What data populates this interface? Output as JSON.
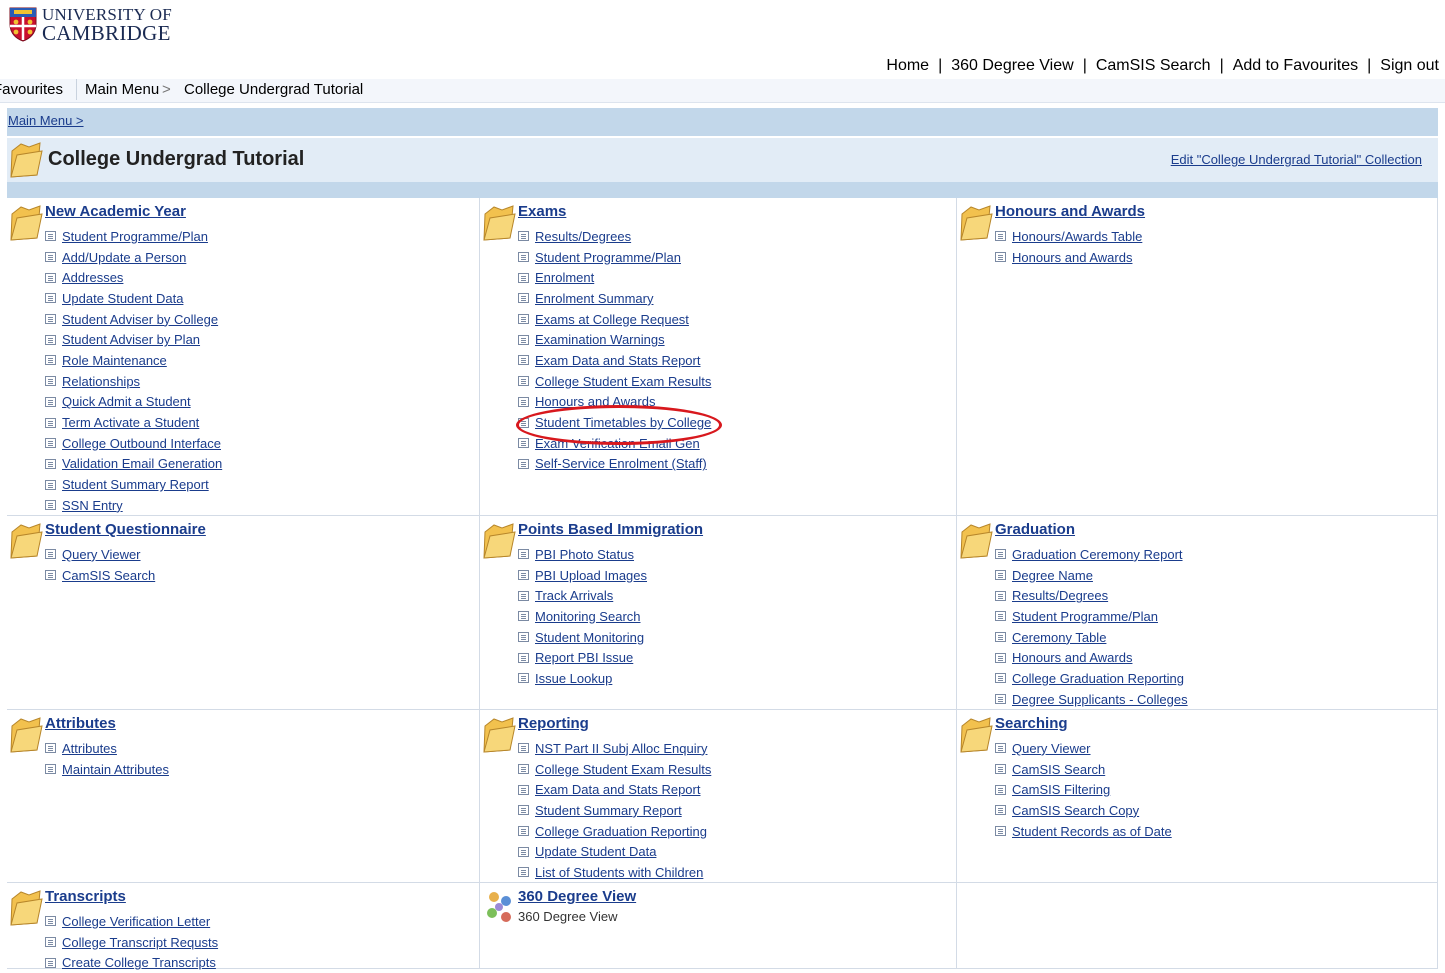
{
  "brand": {
    "line1": "UNIVERSITY OF",
    "line2": "CAMBRIDGE"
  },
  "topnav": [
    "Home",
    "360 Degree View",
    "CamSIS Search",
    "Add to Favourites",
    "Sign out"
  ],
  "crumbbar": {
    "favourites": "Favourites",
    "main_menu": "Main Menu",
    "sep": ">",
    "current": "College Undergrad Tutorial"
  },
  "mainbar": {
    "link": "Main Menu >"
  },
  "page": {
    "title": "College Undergrad Tutorial",
    "edit_link": "Edit \"College Undergrad Tutorial\" Collection"
  },
  "colors": {
    "link": "#1a3c8c",
    "highlight_ring": "#d8181d",
    "bar": "#c2d7ea",
    "title_bar": "#e2ecf6"
  },
  "sections": [
    {
      "title": "New Academic Year",
      "icon": "folder-icon",
      "items": [
        "Student Programme/Plan",
        "Add/Update a Person",
        "Addresses",
        "Update Student Data",
        "Student Adviser by College",
        "Student Adviser by Plan",
        "Role Maintenance",
        "Relationships",
        "Quick Admit a Student",
        "Term Activate a Student",
        "College Outbound Interface",
        "Validation Email Generation",
        "Student Summary Report",
        "SSN Entry"
      ]
    },
    {
      "title": "Exams",
      "icon": "folder-icon",
      "items": [
        "Results/Degrees",
        "Student Programme/Plan",
        "Enrolment",
        "Enrolment Summary",
        "Exams at College Request",
        "Examination Warnings",
        "Exam Data and Stats Report",
        "College Student Exam Results",
        "Honours and Awards",
        "Student Timetables by College",
        "Exam Verification Email Gen",
        "Self-Service Enrolment (Staff)"
      ]
    },
    {
      "title": "Honours and Awards",
      "icon": "folder-icon",
      "items": [
        "Honours/Awards Table",
        "Honours and Awards"
      ]
    },
    {
      "title": "Student Questionnaire",
      "icon": "folder-icon",
      "items": [
        "Query Viewer",
        "CamSIS Search"
      ]
    },
    {
      "title": "Points Based Immigration",
      "icon": "folder-icon",
      "items": [
        "PBI Photo Status",
        "PBI Upload Images",
        "Track Arrivals",
        "Monitoring Search",
        "Student Monitoring",
        "Report PBI Issue",
        "Issue Lookup"
      ]
    },
    {
      "title": "Graduation",
      "icon": "folder-icon",
      "items": [
        "Graduation Ceremony Report",
        "Degree Name",
        "Results/Degrees",
        "Student Programme/Plan",
        "Ceremony Table",
        "Honours and Awards",
        "College Graduation Reporting",
        "Degree Supplicants - Colleges"
      ]
    },
    {
      "title": "Attributes",
      "icon": "folder-icon",
      "items": [
        "Attributes",
        "Maintain Attributes"
      ]
    },
    {
      "title": "Reporting",
      "icon": "folder-icon",
      "items": [
        "NST Part II Subj Alloc Enquiry",
        "College Student Exam Results",
        "Exam Data and Stats Report",
        "Student Summary Report",
        "College Graduation Reporting",
        "Update Student Data",
        "List of Students with Children"
      ]
    },
    {
      "title": "Searching",
      "icon": "folder-icon",
      "items": [
        "Query Viewer",
        "CamSIS Search",
        "CamSIS Filtering",
        "CamSIS Search Copy",
        "Student Records as of Date"
      ]
    },
    {
      "title": "Transcripts",
      "icon": "folder-icon",
      "items": [
        "College Verification Letter",
        "College Transcript Requsts",
        "Create College Transcripts"
      ]
    },
    {
      "title": "360 Degree View",
      "icon": "people-icon",
      "subtitle": "360 Degree View",
      "items": []
    },
    {
      "title": "",
      "icon": "",
      "items": []
    }
  ]
}
